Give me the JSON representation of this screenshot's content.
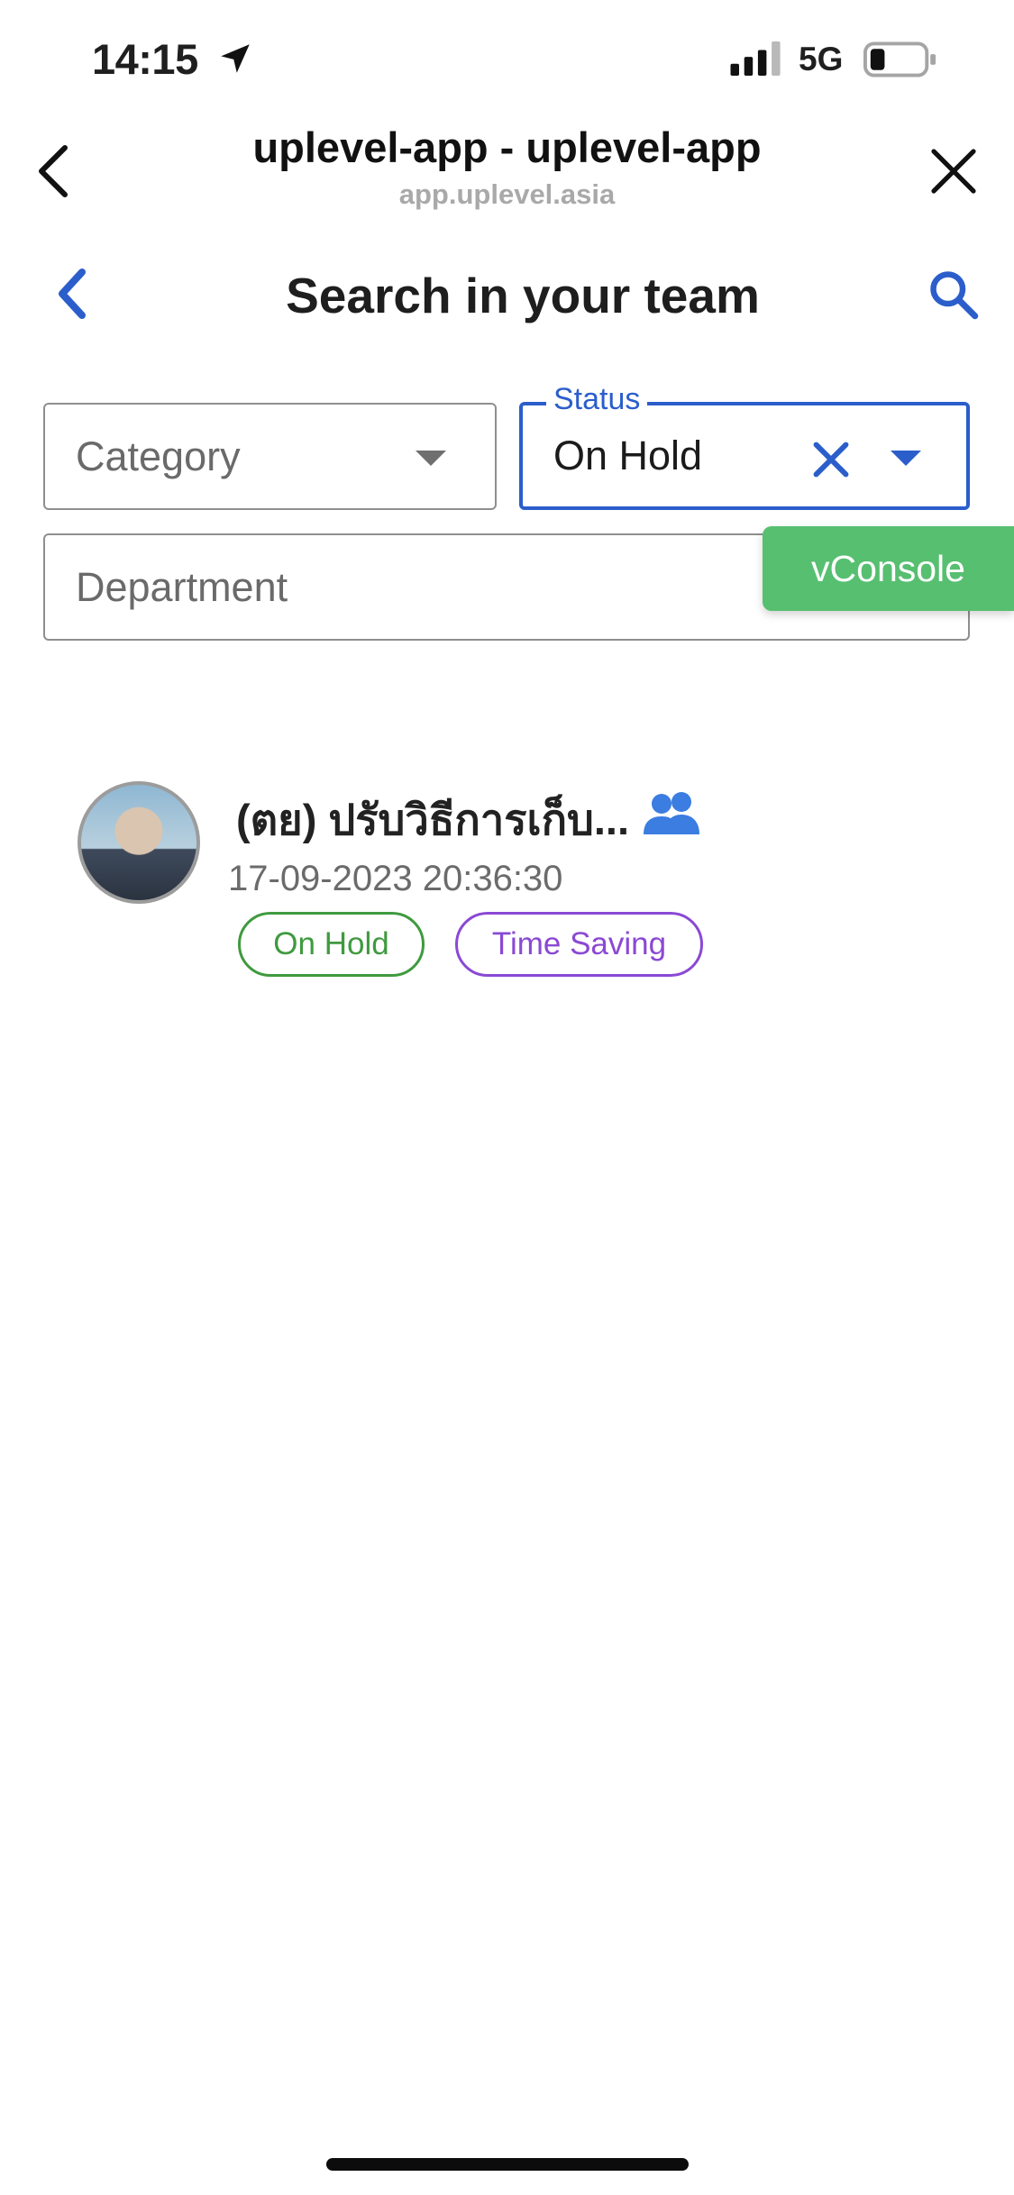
{
  "status_bar": {
    "time": "14:15",
    "network": "5G",
    "icons": [
      "location-arrow-icon",
      "signal-icon",
      "battery-icon"
    ]
  },
  "webview": {
    "title": "uplevel-app - uplevel-app",
    "url": "app.uplevel.asia",
    "icons": [
      "chevron-left-icon",
      "close-icon"
    ]
  },
  "header": {
    "title": "Search in your team",
    "icons": [
      "back-icon",
      "search-icon"
    ]
  },
  "filters": {
    "category_placeholder": "Category",
    "status_label": "Status",
    "status_value": "On Hold",
    "department_placeholder": "Department"
  },
  "vconsole": {
    "label": "vConsole"
  },
  "results": [
    {
      "title": "(ตย) ปรับวิธีการเก็บ...",
      "date": "17-09-2023 20:36:30",
      "tags": [
        "On Hold",
        "Time Saving"
      ],
      "icon": "group-icon"
    }
  ],
  "colors": {
    "primary": "#2b5ecb",
    "on_hold": "#3f9a3f",
    "time_saving": "#8a49d4",
    "vconsole": "#57bf70"
  }
}
